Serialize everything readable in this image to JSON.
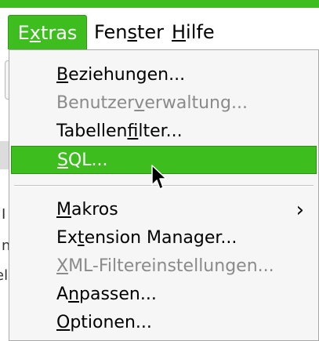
{
  "menubar": {
    "items": [
      {
        "pre": "E",
        "u": "x",
        "post": "tras"
      },
      {
        "pre": "Fen",
        "u": "s",
        "post": "ter"
      },
      {
        "pre": "",
        "u": "H",
        "post": "ilfe"
      }
    ]
  },
  "menu": {
    "items": [
      {
        "pre": "",
        "u": "B",
        "post": "eziehungen..."
      },
      {
        "pre": "Benutzer",
        "u": "v",
        "post": "erwaltung..."
      },
      {
        "pre": "Tabellen",
        "u": "f",
        "post": "ilter..."
      },
      {
        "pre": "",
        "u": "S",
        "post": "QL..."
      },
      {
        "pre": "",
        "u": "M",
        "post": "akros"
      },
      {
        "pre": "Ex",
        "u": "t",
        "post": "ension Manager..."
      },
      {
        "pre": "",
        "u": "X",
        "post": "ML-Filtereinstellungen..."
      },
      {
        "pre": "A",
        "u": "n",
        "post": "passen..."
      },
      {
        "pre": "",
        "u": "O",
        "post": "ptionen..."
      }
    ],
    "submenu_arrow": "›"
  },
  "background": {
    "chars": [
      "I",
      "n",
      "el"
    ]
  },
  "colors": {
    "accent": "#3ebd1f",
    "menu_bg": "#f6f6f6",
    "disabled_text": "#8a8a8a"
  },
  "icons": {
    "cursor": "arrow-pointer-icon",
    "submenu": "chevron-right-icon"
  }
}
